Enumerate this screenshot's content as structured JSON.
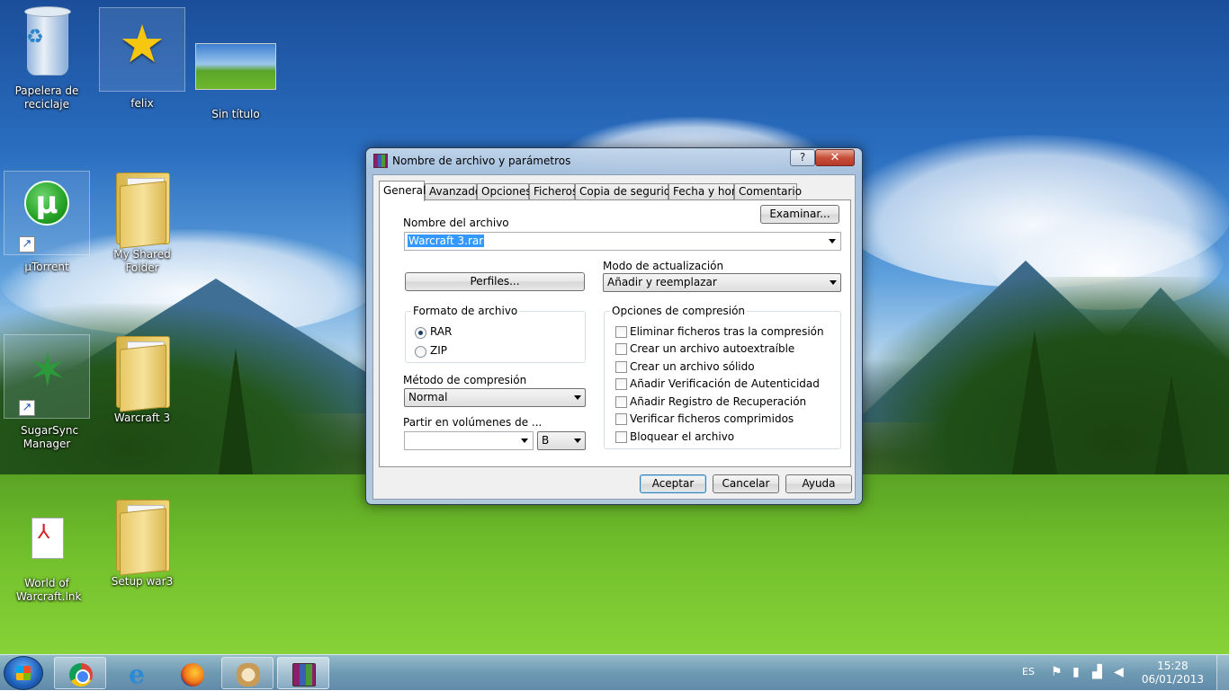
{
  "desktop": {
    "icons": [
      {
        "label": "Papelera de reciclaje",
        "icon": "recycle-bin-icon"
      },
      {
        "label": "felix",
        "icon": "star-icon"
      },
      {
        "label": "Sin título",
        "icon": "image-thumbnail-icon"
      },
      {
        "label": "µTorrent",
        "icon": "utorrent-icon"
      },
      {
        "label": "My Shared Folder",
        "icon": "folder-icon"
      },
      {
        "label": "SugarSync Manager",
        "icon": "sugarsync-icon"
      },
      {
        "label": "Warcraft 3",
        "icon": "folder-icon"
      },
      {
        "label": "World of Warcraft.lnk",
        "icon": "pdf-document-icon"
      },
      {
        "label": "Setup war3",
        "icon": "folder-icon"
      }
    ]
  },
  "dialog": {
    "title": "Nombre de archivo y parámetros",
    "help_glyph": "?",
    "close_glyph": "✕",
    "tabs": [
      "General",
      "Avanzado",
      "Opciones",
      "Ficheros",
      "Copia de seguridad",
      "Fecha y hora",
      "Comentario"
    ],
    "active_tab": "General",
    "archive_name_label": "Nombre del archivo",
    "archive_name_value": "Warcraft 3.rar",
    "browse_label": "Examinar...",
    "profiles_label": "Perfiles...",
    "update_mode_label": "Modo de actualización",
    "update_mode_value": "Añadir y reemplazar",
    "format_group_label": "Formato de archivo",
    "format_options": [
      {
        "label": "RAR",
        "checked": true
      },
      {
        "label": "ZIP",
        "checked": false
      }
    ],
    "compression_method_label": "Método de compresión",
    "compression_method_value": "Normal",
    "split_label": "Partir en volúmenes de ...",
    "split_value": "",
    "split_unit": "B",
    "options_group_label": "Opciones de compresión",
    "options": [
      {
        "label": "Eliminar ficheros tras la compresión",
        "checked": false
      },
      {
        "label": "Crear un archivo autoextraíble",
        "checked": false
      },
      {
        "label": "Crear un archivo sólido",
        "checked": false
      },
      {
        "label": "Añadir Verificación de Autenticidad",
        "checked": false
      },
      {
        "label": "Añadir Registro de Recuperación",
        "checked": false
      },
      {
        "label": "Verificar ficheros comprimidos",
        "checked": false
      },
      {
        "label": "Bloquear el archivo",
        "checked": false
      }
    ],
    "buttons": {
      "ok": "Aceptar",
      "cancel": "Cancelar",
      "help": "Ayuda"
    }
  },
  "taskbar": {
    "pinned": [
      "chrome-icon",
      "internet-explorer-icon",
      "firefox-icon",
      "paint-icon",
      "winrar-icon"
    ],
    "tray": {
      "language": "ES",
      "time": "15:28",
      "date": "06/01/2013"
    }
  },
  "colors": {
    "selection": "#3399ff",
    "close_button": "#c7503a",
    "title_glass": "#aac3de"
  }
}
